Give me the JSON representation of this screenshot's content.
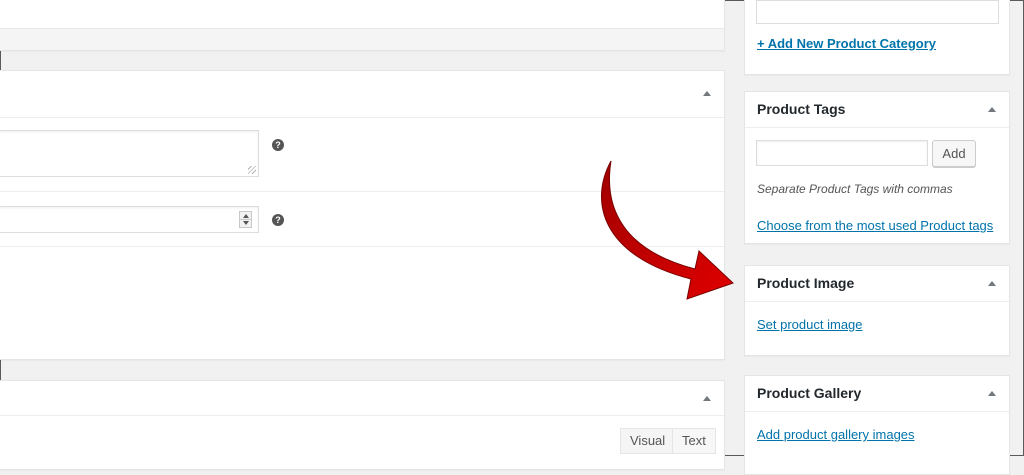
{
  "sidebar": {
    "category": {
      "add_link": "+ Add New Product Category"
    },
    "tags": {
      "title": "Product Tags",
      "add_button": "Add",
      "hint": "Separate Product Tags with commas",
      "choose_link": "Choose from the most used Product tags"
    },
    "image": {
      "title": "Product Image",
      "set_link": "Set product image"
    },
    "gallery": {
      "title": "Product Gallery",
      "add_link": "Add product gallery images"
    }
  },
  "main": {
    "help_icon": "?",
    "editor_tabs": {
      "visual": "Visual",
      "text": "Text"
    }
  },
  "colors": {
    "link": "#0073aa",
    "arrow": "#d40000",
    "background": "#f1f1f1"
  },
  "icons": [
    "toggle-arrow-icon",
    "help-icon",
    "spinner-icon",
    "resize-grip-icon",
    "red-pointer-arrow-icon"
  ]
}
